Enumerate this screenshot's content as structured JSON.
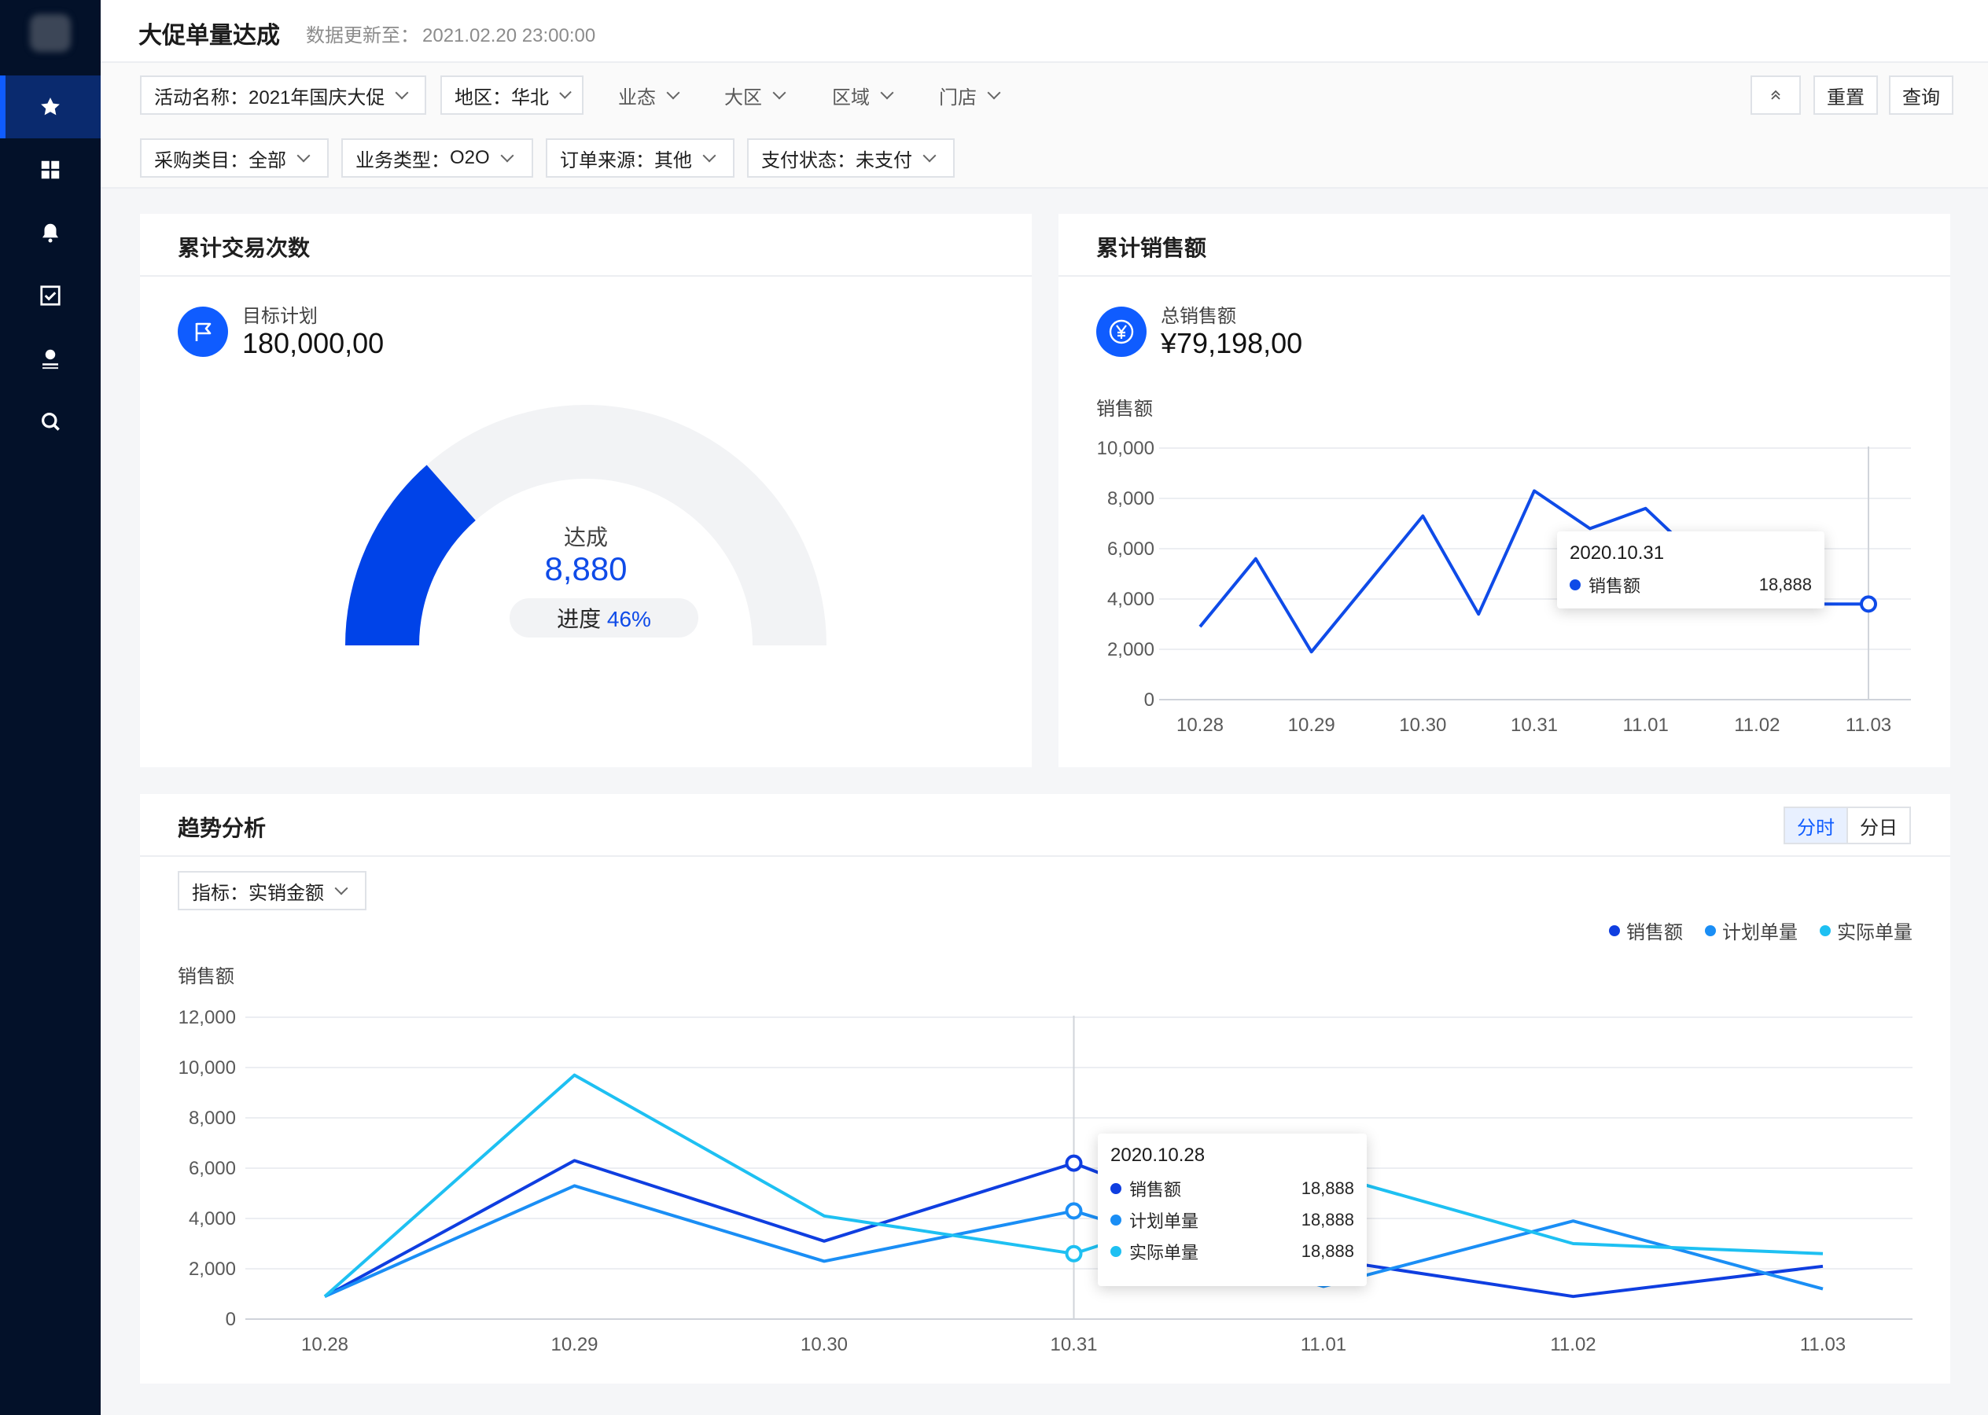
{
  "sidebar": {
    "items": [
      {
        "icon": "star-icon",
        "active": true
      },
      {
        "icon": "grid-icon",
        "active": false
      },
      {
        "icon": "bell-icon",
        "active": false
      },
      {
        "icon": "checkbox-icon",
        "active": false
      },
      {
        "icon": "user-icon",
        "active": false
      },
      {
        "icon": "search-icon",
        "active": false
      }
    ]
  },
  "header": {
    "title": "大促单量达成",
    "update_label": "数据更新至：",
    "update_time": "2021.02.20 23:00:00"
  },
  "filters": {
    "row1": [
      {
        "label": "活动名称：",
        "value": "2021年国庆大促"
      },
      {
        "label": "地区：",
        "value": "华北"
      },
      {
        "label": "业态",
        "value": ""
      },
      {
        "label": "大区",
        "value": ""
      },
      {
        "label": "区域",
        "value": ""
      },
      {
        "label": "门店",
        "value": ""
      }
    ],
    "row2": [
      {
        "label": "采购类目：",
        "value": "全部"
      },
      {
        "label": "业务类型：",
        "value": "O2O"
      },
      {
        "label": "订单来源：",
        "value": "其他"
      },
      {
        "label": "支付状态：",
        "value": "未支付"
      }
    ],
    "collapse_icon": "double-chevron-up-icon",
    "reset_label": "重置",
    "query_label": "查询"
  },
  "transactions": {
    "title": "累计交易次数",
    "kpi_icon": "flag-icon",
    "kpi_label": "目标计划",
    "kpi_value": "180,000,00",
    "gauge_label": "达成",
    "gauge_value": "8,880",
    "progress_label": "进度",
    "progress_text": "46%",
    "progress_fraction": 0.27,
    "colors": {
      "fill": "#0043e8",
      "track": "#f2f3f5"
    }
  },
  "sales": {
    "title": "累计销售额",
    "kpi_icon": "yuan-icon",
    "kpi_label": "总销售额",
    "kpi_value": "¥79,198,00",
    "chart_data": {
      "type": "line",
      "ylabel": "销售额",
      "ylim": [
        0,
        10000
      ],
      "yticks": [
        0,
        2000,
        4000,
        6000,
        8000,
        10000
      ],
      "ytick_labels": [
        "0",
        "2,000",
        "4,000",
        "6,000",
        "8,000",
        "10,000"
      ],
      "categories": [
        "10.28",
        "10.29",
        "10.30",
        "10.31",
        "11.01",
        "11.02",
        "11.03"
      ],
      "x": [
        0,
        0.5,
        1,
        1.5,
        2,
        2.5,
        3,
        3.5,
        4,
        4.5,
        5,
        5.5,
        6
      ],
      "values": [
        2900,
        5600,
        1900,
        4600,
        7300,
        3400,
        8300,
        6800,
        7600,
        5500,
        3800,
        3800,
        3800
      ],
      "color": "#0f4be8",
      "highlight_index": 6,
      "tooltip": {
        "title": "2020.10.31",
        "rows": [
          {
            "name": "销售额",
            "value": "18,888",
            "color": "#0f4be8"
          }
        ]
      }
    }
  },
  "trend": {
    "title": "趋势分析",
    "toggle": [
      "分时",
      "分日"
    ],
    "metric_filter": {
      "label": "指标：",
      "value": "实销金额"
    },
    "chart_data": {
      "type": "line",
      "ylabel": "销售额",
      "ylim": [
        0,
        12000
      ],
      "yticks": [
        0,
        2000,
        4000,
        6000,
        8000,
        10000,
        12000
      ],
      "ytick_labels": [
        "0",
        "2,000",
        "4,000",
        "6,000",
        "8,000",
        "10,000",
        "12,000"
      ],
      "categories": [
        "10.28",
        "10.29",
        "10.30",
        "10.31",
        "11.01",
        "11.02",
        "11.03"
      ],
      "legend_position": "top-right",
      "series": [
        {
          "name": "销售额",
          "color": "#0f3ee0",
          "values": [
            900,
            6300,
            3100,
            6200,
            2400,
            900,
            2100
          ]
        },
        {
          "name": "计划单量",
          "color": "#1a8ef5",
          "values": [
            900,
            5300,
            2300,
            4300,
            1300,
            3900,
            1200
          ]
        },
        {
          "name": "实际单量",
          "color": "#1ec0f2",
          "values": [
            900,
            9700,
            4100,
            2600,
            5800,
            3000,
            2600
          ]
        }
      ],
      "highlight_index": 3,
      "tooltip": {
        "title": "2020.10.28",
        "rows": [
          {
            "name": "销售额",
            "value": "18,888",
            "color": "#0f3ee0"
          },
          {
            "name": "计划单量",
            "value": "18,888",
            "color": "#1a8ef5"
          },
          {
            "name": "实际单量",
            "value": "18,888",
            "color": "#1ec0f2"
          }
        ]
      }
    }
  }
}
